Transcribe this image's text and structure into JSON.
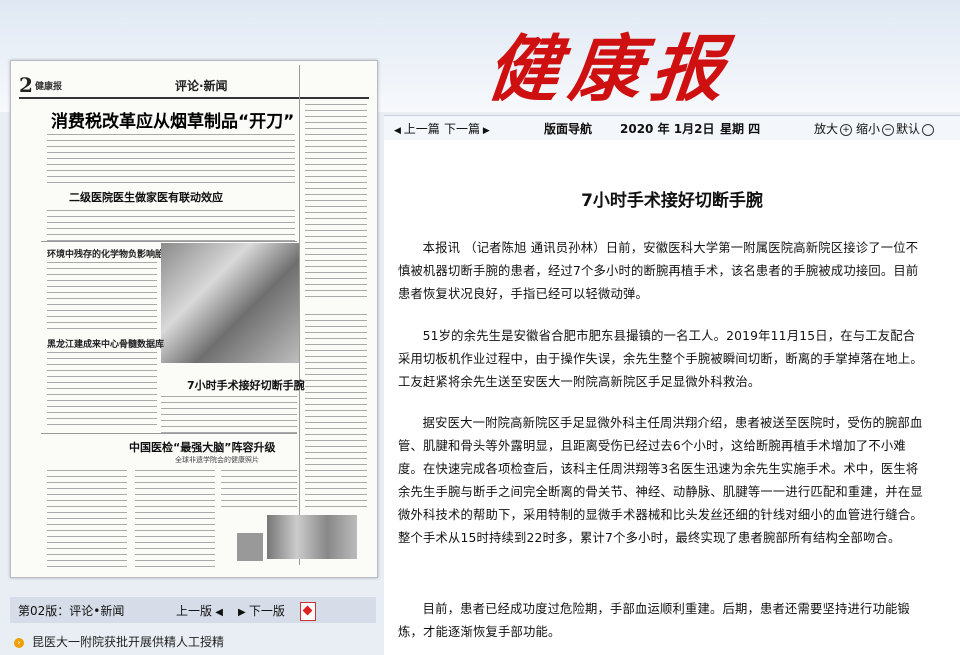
{
  "brand": {
    "logo": "健康报"
  },
  "paper": {
    "page_num": "2",
    "brand_small": "健康报",
    "section": "评论·新闻",
    "h1": "消费税改革应从烟草制品“开刀”",
    "h2": "二级医院医生做家医有联动效应",
    "h3": "环境中残存的化学物负影响胎儿",
    "h4": "黑龙江建成来中心骨髓数据库",
    "h5": "7小时手术接好切断手腕",
    "h6": "中国医检“最强大脑”阵容升级",
    "sub": "全球非遗学院会的健康照片"
  },
  "pagebar": {
    "page": "第02版：评论•新闻",
    "prev": "上一版",
    "next": "下一版"
  },
  "list": {
    "items": [
      {
        "label": "昆医大一附院获批开展供精人工授精"
      }
    ]
  },
  "toolbar": {
    "prev": "上一篇",
    "next": "下一篇",
    "nav": "版面导航",
    "date": "2020 年 1月2日",
    "weekday": "星期 四",
    "zoom_in": "放大",
    "zoom_out": "缩小",
    "default": "默认"
  },
  "article": {
    "title": "7小时手术接好切断手腕",
    "paragraphs": [
      "本报讯 （记者陈旭 通讯员孙林）日前，安徽医科大学第一附属医院高新院区接诊了一位不慎被机器切断手腕的患者，经过7个多小时的断腕再植手术，该名患者的手腕被成功接回。目前患者恢复状况良好，手指已经可以轻微动弹。",
      "51岁的余先生是安徽省合肥市肥东县撮镇的一名工人。2019年11月15日，在与工友配合采用切板机作业过程中，由于操作失误，余先生整个手腕被瞬间切断，断离的手掌掉落在地上。工友赶紧将余先生送至安医大一附院高新院区手足显微外科救治。",
      "据安医大一附院高新院区手足显微外科主任周洪翔介绍，患者被送至医院时，受伤的腕部血管、肌腱和骨头等外露明显，且距离受伤已经过去6个小时，这给断腕再植手术增加了不小难度。在快速完成各项检查后，该科主任周洪翔等3名医生迅速为余先生实施手术。术中，医生将余先生手腕与断手之间完全断离的骨关节、神经、动静脉、肌腱等一一进行匹配和重建，并在显微外科技术的帮助下，采用特制的显微手术器械和比头发丝还细的针线对细小的血管进行缝合。整个手术从15时持续到22时多，累计7个多小时，最终实现了患者腕部所有结构全部吻合。",
      "目前，患者已经成功度过危险期，手部血运顺利重建。后期，患者还需要坚持进行功能锻炼，才能逐渐恢复手部功能。"
    ]
  },
  "colors": {
    "logo": "#cf1010",
    "bullet": "#f0a000",
    "background": "#e9eef5"
  },
  "icons": [
    "arrow-left-icon",
    "arrow-right-icon",
    "pdf-icon",
    "zoom-in-icon",
    "zoom-out-icon",
    "default-icon",
    "bullet-icon"
  ]
}
